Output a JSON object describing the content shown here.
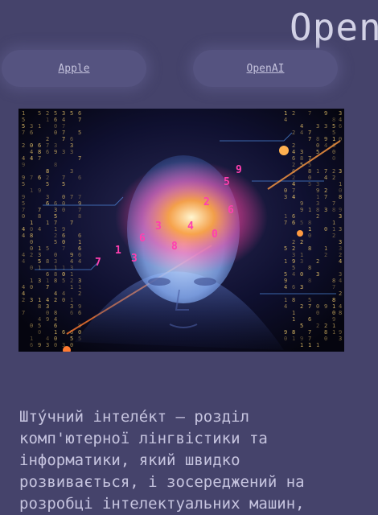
{
  "header": {
    "title": "Open"
  },
  "nav": {
    "links": [
      {
        "label": "Apple"
      },
      {
        "label": "OpenAI"
      }
    ]
  },
  "hero": {
    "icon": "ai-head-illustration"
  },
  "content": {
    "intro": "Шту́чний інтеле́кт — розділ комп'ютерної лінгвістики та інформатики, який швидко розвивається, і зосереджений на розробці інтелектуальних машин,"
  },
  "colors": {
    "background": "#45436b",
    "text": "#c6c4df",
    "title": "#d3d2e6"
  }
}
